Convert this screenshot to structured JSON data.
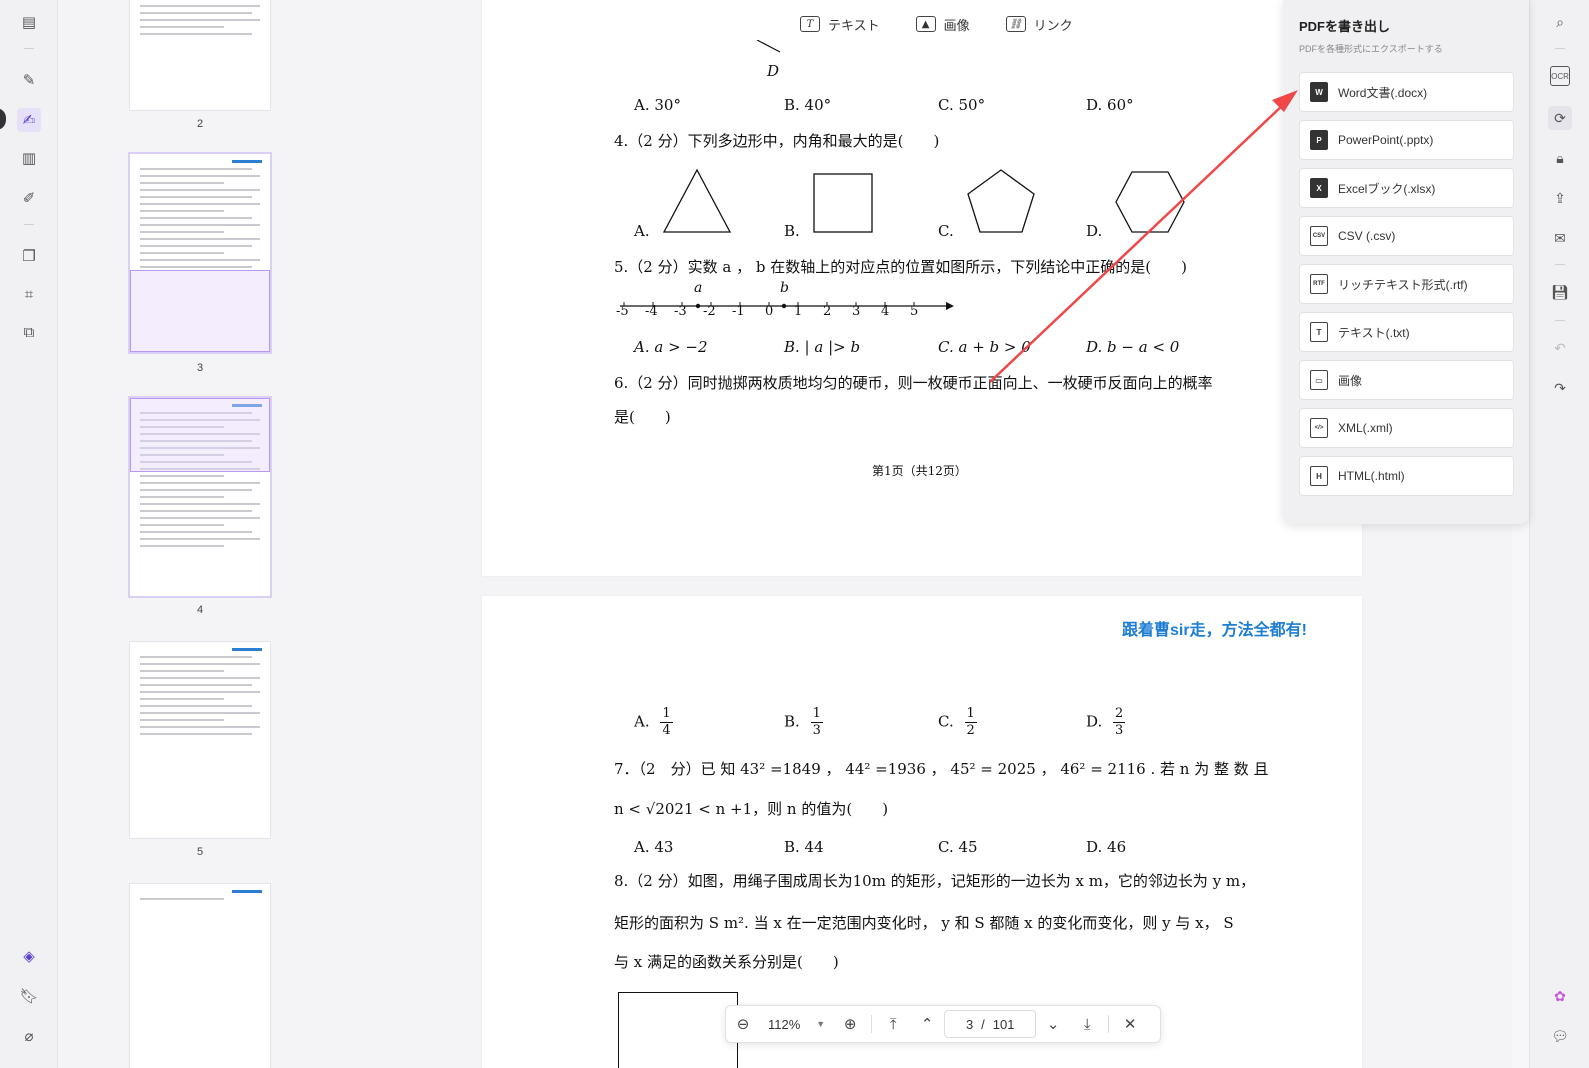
{
  "top_toolbar": {
    "text_label": "テキスト",
    "image_label": "画像",
    "link_label": "リンク",
    "text_icon_glyph": "T"
  },
  "thumbnails": [
    {
      "page": "2"
    },
    {
      "page": "3"
    },
    {
      "page": "4"
    },
    {
      "page": "5"
    }
  ],
  "doc": {
    "page1": {
      "point_d": "D",
      "q3_options": [
        "A.   30°",
        "B.   40°",
        "C.   50°",
        "D.   60°"
      ],
      "q4": "4.（2 分）下列多边形中，内角和最大的是(　　)",
      "q4_labels": [
        "A.",
        "B.",
        "C.",
        "D."
      ],
      "q5": "5.（2 分）实数 a ，  b 在数轴上的对应点的位置如图所示，下列结论中正确的是(　　)",
      "numberline_ticks": [
        "-5",
        "-4",
        "-3",
        "-2",
        "-1",
        "0",
        "1",
        "2",
        "3",
        "4",
        "5"
      ],
      "numberline_a": "a",
      "numberline_b": "b",
      "q5_options": [
        "A.   a > −2",
        "B.   | a |> b",
        "C.   a + b > 0",
        "D.   b − a < 0"
      ],
      "q6_line1": "6.（2 分）同时抛掷两枚质地均匀的硬币，则一枚硬币正面向上、一枚硬币反面向上的概率",
      "q6_line2": "是(　　)",
      "footer": "第1页（共12页）"
    },
    "page2": {
      "header": "跟着曹sir走，方法全都有!",
      "q6_options": [
        {
          "label": "A.",
          "num": "1",
          "den": "4"
        },
        {
          "label": "B.",
          "num": "1",
          "den": "3"
        },
        {
          "label": "C.",
          "num": "1",
          "den": "2"
        },
        {
          "label": "D.",
          "num": "2",
          "den": "3"
        }
      ],
      "q7_line1": "7．（2　分）已 知 43² =1849 ，   44² =1936 ，  45² = 2025 ，  46² = 2116 .  若 n 为 整 数 且",
      "q7_line2": "n < √2021 < n +1，则 n 的值为(　　)",
      "q7_options": [
        "A.  43",
        "B.  44",
        "C.  45",
        "D.  46"
      ],
      "q8_line1": "8.（2 分）如图，用绳子围成周长为10m 的矩形，记矩形的一边长为 x m，它的邻边长为 y m，",
      "q8_line2": "矩形的面积为 S m².  当 x 在一定范围内变化时，  y 和 S 都随 x 的变化而变化，则 y 与 x，  S",
      "q8_line3": "与 x 满足的函数关系分别是(　　)"
    }
  },
  "export_panel": {
    "title": "PDFを書き出し",
    "subtitle": "PDFを各種形式にエクスポートする",
    "items": [
      {
        "label": "Word文書(.docx)",
        "icon": "word-icon",
        "glyph": "W"
      },
      {
        "label": "PowerPoint(.pptx)",
        "icon": "powerpoint-icon",
        "glyph": "P"
      },
      {
        "label": "Excelブック(.xlsx)",
        "icon": "excel-icon",
        "glyph": "X"
      },
      {
        "label": "CSV (.csv)",
        "icon": "csv-icon",
        "glyph": "CSV"
      },
      {
        "label": "リッチテキスト形式(.rtf)",
        "icon": "rtf-icon",
        "glyph": "RTF"
      },
      {
        "label": "テキスト(.txt)",
        "icon": "txt-icon",
        "glyph": "T"
      },
      {
        "label": "画像",
        "icon": "image-icon",
        "glyph": "▭"
      },
      {
        "label": "XML(.xml)",
        "icon": "xml-icon",
        "glyph": "</>"
      },
      {
        "label": "HTML(.html)",
        "icon": "html-icon",
        "glyph": "H"
      }
    ]
  },
  "bottom_bar": {
    "zoom": "112%",
    "current_page": "3",
    "separator": "/",
    "total_pages": "101"
  },
  "colors": {
    "accent": "#5b3fd0",
    "arrow": "#f04848",
    "header_blue": "#1e7ed4"
  }
}
